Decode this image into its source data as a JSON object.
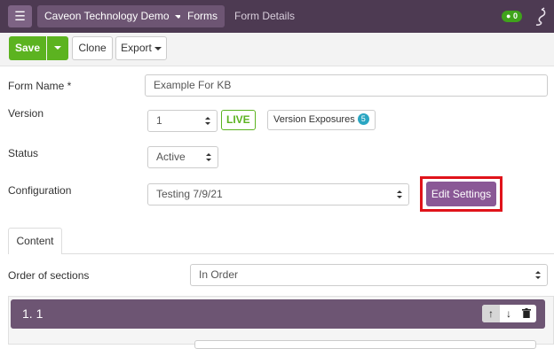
{
  "topbar": {
    "menu_icon": "hamburger-icon",
    "org_label": "Caveon Technology Demo",
    "forms_label": "Forms",
    "breadcrumb_current": "Form Details",
    "notification_count": "0",
    "logo_icon": "scorpion-logo-icon",
    "bell_icon": "bell-icon"
  },
  "toolbar": {
    "save_label": "Save",
    "clone_label": "Clone",
    "export_label": "Export"
  },
  "form": {
    "name_label": "Form Name *",
    "name_value": "Example For KB",
    "version_label": "Version",
    "version_value": "1",
    "live_label": "LIVE",
    "exposures_label": "Version Exposures",
    "exposures_count": "5",
    "status_label": "Status",
    "status_value": "Active",
    "configuration_label": "Configuration",
    "configuration_value": "Testing 7/9/21",
    "edit_settings_label": "Edit Settings"
  },
  "tabs": [
    {
      "label": "Content"
    }
  ],
  "content": {
    "order_label": "Order of sections",
    "order_value": "In Order",
    "section_title": "1. 1",
    "tool_icons": [
      "arrow-up-icon",
      "arrow-down-icon",
      "trash-icon"
    ]
  },
  "colors": {
    "topbar": "#4d3a52",
    "accent_purple": "#8a5896",
    "save_green": "#5cb320",
    "highlight_red": "#e0131a"
  }
}
